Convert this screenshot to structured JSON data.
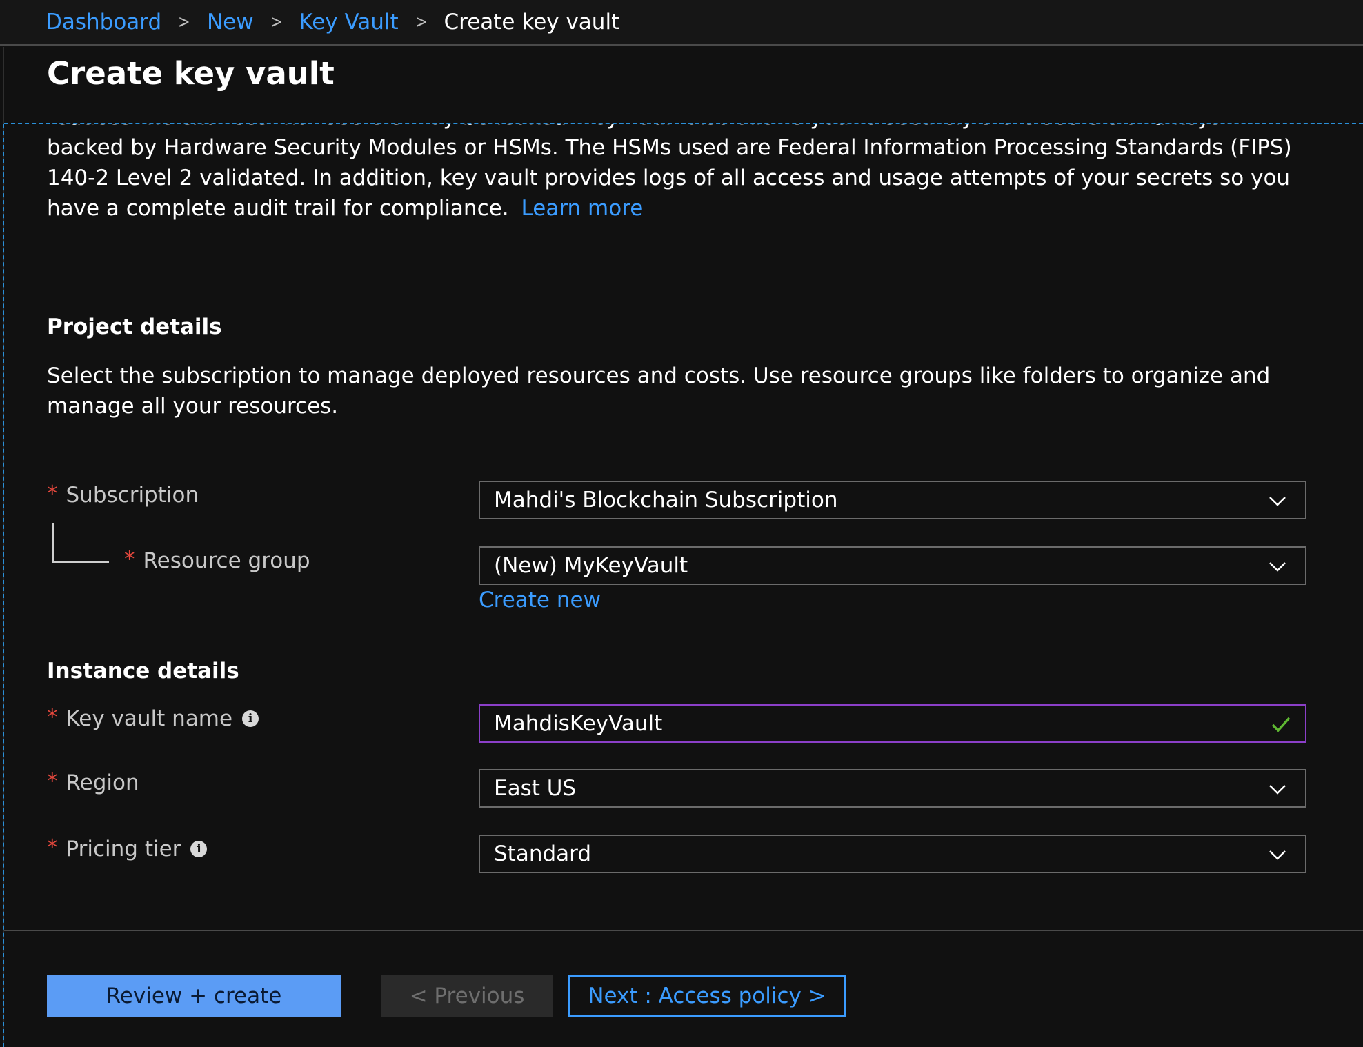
{
  "breadcrumb": {
    "items": [
      "Dashboard",
      "New",
      "Key Vault"
    ],
    "current": "Create key vault",
    "separator": ">"
  },
  "page": {
    "title": "Create key vault"
  },
  "description": {
    "text": "reduces the chances that secrets may be leaked. Key Vault also allows you to securely store secrets and keys backed by Hardware Security Modules or HSMs. The HSMs used are Federal Information Processing Standards (FIPS) 140-2 Level 2 validated. In addition, key vault provides logs of all access and usage attempts of your secrets so you have a complete audit trail for compliance.",
    "learn_more": "Learn more"
  },
  "project_details": {
    "heading": "Project details",
    "description": "Select the subscription to manage deployed resources and costs. Use resource groups like folders to organize and manage all your resources.",
    "subscription": {
      "label": "Subscription",
      "value": "Mahdi's Blockchain Subscription"
    },
    "resource_group": {
      "label": "Resource group",
      "value": "(New) MyKeyVault",
      "create_new": "Create new"
    }
  },
  "instance_details": {
    "heading": "Instance details",
    "key_vault_name": {
      "label": "Key vault name",
      "value": "MahdisKeyVault"
    },
    "region": {
      "label": "Region",
      "value": "East US"
    },
    "pricing_tier": {
      "label": "Pricing tier",
      "value": "Standard"
    }
  },
  "required_marker": "*",
  "info_glyph": "i",
  "footer": {
    "review_create": "Review + create",
    "previous": "< Previous",
    "next": "Next : Access policy >"
  },
  "colors": {
    "background": "#111111",
    "link": "#3b9cff",
    "required": "#e5483d",
    "primary_button": "#5b9cf5",
    "valid_border": "#8b3fc8",
    "valid_check": "#5fb832"
  },
  "icons": [
    "chevron-right-icon",
    "chevron-down-icon",
    "info-icon",
    "checkmark-icon"
  ]
}
